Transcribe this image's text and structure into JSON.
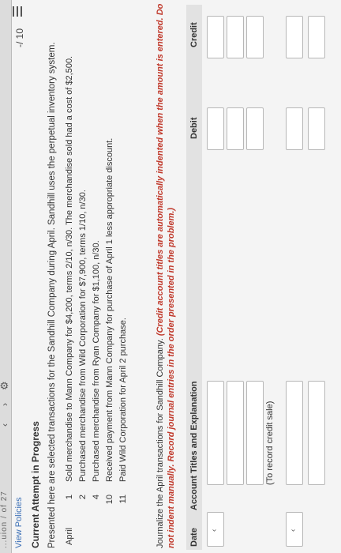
{
  "header": {
    "partial_title": "...uion / of 27",
    "view_policies": "View Policies",
    "score": "-/ 10"
  },
  "page": {
    "attempt_title": "Current Attempt in Progress",
    "intro": "Presented here are selected transactions for the Sandhill Company during April. Sandhill uses the perpetual inventory system."
  },
  "transactions": [
    {
      "month": "April",
      "day": "1",
      "text": "Sold merchandise to Mann Company for $4,200, terms 2/10, n/30. The merchandise sold had a cost of $2,500."
    },
    {
      "month": "",
      "day": "2",
      "text": "Purchased merchandise from Wild Corporation for $7,900, terms 1/10, n/30."
    },
    {
      "month": "",
      "day": "4",
      "text": "Purchased merchandise from Ryan Company for $1,100, n/30."
    },
    {
      "month": "",
      "day": "10",
      "text": "Received payment from Mann Company for purchase of April 1 less appropriate discount."
    },
    {
      "month": "",
      "day": "11",
      "text": "Paid Wild Corporation for April 2 purchase."
    }
  ],
  "instructions": {
    "plain": "Journalize the April transactions for Sandhill Company.",
    "emphasis": "(Credit account titles are automatically indented when the amount is entered. Do not indent manually. Record journal entries in the order presented in the problem.)"
  },
  "journal": {
    "col_date": "Date",
    "col_account": "Account Titles and Explanation",
    "col_debit": "Debit",
    "col_credit": "Credit",
    "note": "(To record credit sale)",
    "date_chevron": "‹"
  },
  "colors": {
    "link": "#3b6fb6",
    "emphasis": "#c0392b",
    "header_bg": "#e2e2e2"
  }
}
